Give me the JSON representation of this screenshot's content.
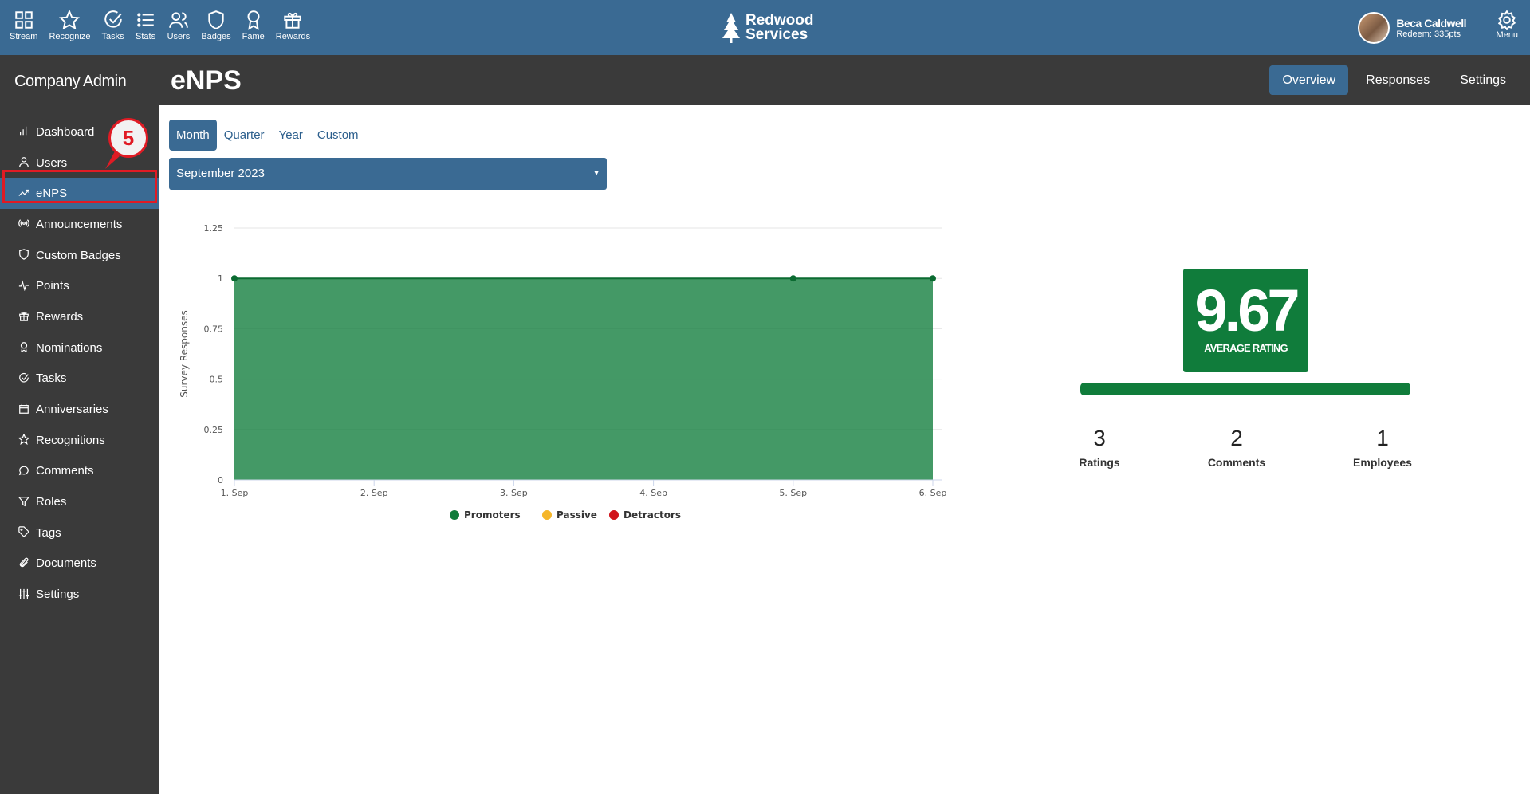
{
  "topnav": {
    "items": [
      {
        "label": "Stream",
        "icon": "grid-icon"
      },
      {
        "label": "Recognize",
        "icon": "star-icon"
      },
      {
        "label": "Tasks",
        "icon": "check-circle-icon"
      },
      {
        "label": "Stats",
        "icon": "list-icon"
      },
      {
        "label": "Users",
        "icon": "users-icon"
      },
      {
        "label": "Badges",
        "icon": "shield-icon"
      },
      {
        "label": "Fame",
        "icon": "award-icon"
      },
      {
        "label": "Rewards",
        "icon": "gift-icon"
      }
    ],
    "brand_line1": "Redwood",
    "brand_line2": "Services",
    "user_name": "Beca Caldwell",
    "user_sub": "Redeem: 335pts",
    "menu_label": "Menu"
  },
  "subheader": {
    "sidebar_title": "Company Admin",
    "page_title": "eNPS",
    "tabs": [
      {
        "label": "Overview",
        "active": true
      },
      {
        "label": "Responses",
        "active": false
      },
      {
        "label": "Settings",
        "active": false
      }
    ]
  },
  "sidebar": {
    "items": [
      {
        "label": "Dashboard",
        "icon": "bar-chart-icon"
      },
      {
        "label": "Users",
        "icon": "user-icon"
      },
      {
        "label": "eNPS",
        "icon": "trend-icon",
        "active": true
      },
      {
        "label": "Announcements",
        "icon": "broadcast-icon"
      },
      {
        "label": "Custom Badges",
        "icon": "shield-icon"
      },
      {
        "label": "Points",
        "icon": "activity-icon"
      },
      {
        "label": "Rewards",
        "icon": "gift-icon"
      },
      {
        "label": "Nominations",
        "icon": "award-icon"
      },
      {
        "label": "Tasks",
        "icon": "check-circle-icon"
      },
      {
        "label": "Anniversaries",
        "icon": "calendar-icon"
      },
      {
        "label": "Recognitions",
        "icon": "star-icon"
      },
      {
        "label": "Comments",
        "icon": "comment-icon"
      },
      {
        "label": "Roles",
        "icon": "filter-icon"
      },
      {
        "label": "Tags",
        "icon": "tag-icon"
      },
      {
        "label": "Documents",
        "icon": "paperclip-icon"
      },
      {
        "label": "Settings",
        "icon": "sliders-icon"
      }
    ],
    "step_badge": "5"
  },
  "period_tabs": [
    {
      "label": "Month",
      "active": true
    },
    {
      "label": "Quarter",
      "active": false
    },
    {
      "label": "Year",
      "active": false
    },
    {
      "label": "Custom",
      "active": false
    }
  ],
  "month_select": {
    "value": "September 2023"
  },
  "chart_data": {
    "type": "area",
    "ylabel": "Survey Responses",
    "x": [
      "1. Sep",
      "2. Sep",
      "3. Sep",
      "4. Sep",
      "5. Sep",
      "6. Sep"
    ],
    "yticks": [
      "0",
      "0.25",
      "0.5",
      "0.75",
      "1",
      "1.25"
    ],
    "ylim": [
      0,
      1.25
    ],
    "series": [
      {
        "name": "Promoters",
        "color": "#107c3b",
        "values": [
          1,
          1,
          1,
          1,
          1,
          1
        ],
        "markers": [
          "1. Sep",
          "5. Sep",
          "6. Sep"
        ]
      },
      {
        "name": "Passive",
        "color": "#f5b62a",
        "values": [
          0,
          0,
          0,
          0,
          0,
          0
        ]
      },
      {
        "name": "Detractors",
        "color": "#d0141b",
        "values": [
          0,
          0,
          0,
          0,
          0,
          0
        ]
      }
    ],
    "grid": true,
    "legend": "bottom"
  },
  "summary": {
    "average_rating": "9.67",
    "average_label": "AVERAGE RATING",
    "stats": [
      {
        "num": "3",
        "label": "Ratings"
      },
      {
        "num": "2",
        "label": "Comments"
      },
      {
        "num": "1",
        "label": "Employees"
      }
    ]
  }
}
